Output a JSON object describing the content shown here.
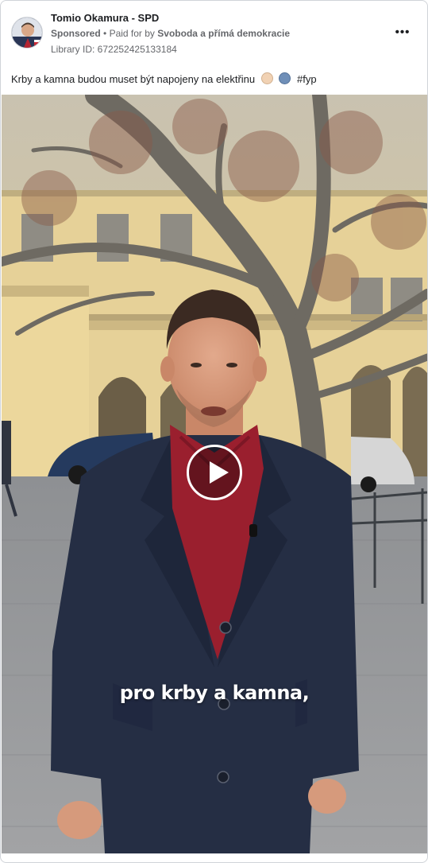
{
  "ad": {
    "page_name": "Tomio Okamura - SPD",
    "sponsored": "Sponsored",
    "separator": "•",
    "paid_for_by": "Paid for by",
    "funder": "Svoboda a přímá demokracie",
    "library_id": "Library ID: 672252425133184",
    "more_icon": "•••",
    "caption_text": "Krby a kamna budou muset být napojeny na elektřinu",
    "caption_hashtag": "#fyp",
    "emojis": [
      "santa-emoji",
      "person-emoji"
    ]
  },
  "video": {
    "subtitle": "pro krby a kamna,",
    "play_icon": "play-icon"
  },
  "colors": {
    "coat": "#262f45",
    "scarf": "#9a1f2e",
    "building": "#e8d39a",
    "pavement": "#9a9c9e",
    "text_secondary": "#65676b"
  }
}
